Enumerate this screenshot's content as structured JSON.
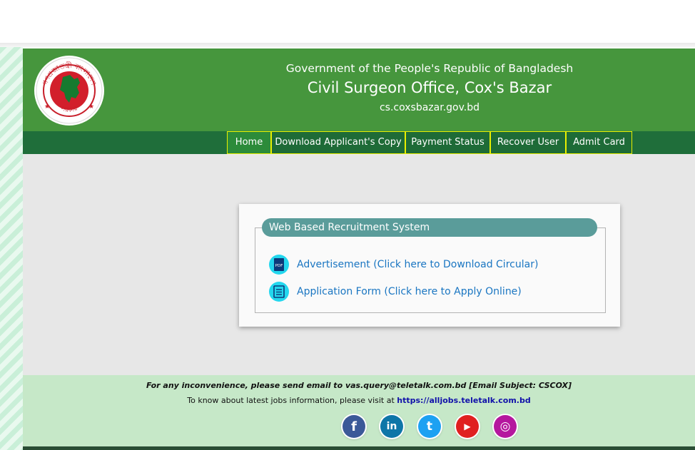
{
  "header": {
    "line1": "Government of the People's Republic of Bangladesh",
    "line2": "Civil Surgeon Office, Cox's Bazar",
    "line3": "cs.coxsbazar.gov.bd",
    "logo_text_top": "গণপ্রজাতন্ত্রী বাংলাদেশ",
    "logo_text_bottom": "সরকার"
  },
  "nav": {
    "items": [
      {
        "label": "Home"
      },
      {
        "label": "Download Applicant's Copy"
      },
      {
        "label": "Payment Status"
      },
      {
        "label": "Recover User"
      },
      {
        "label": "Admit Card"
      }
    ],
    "active": "Home"
  },
  "panel": {
    "legend": "Web Based Recruitment System",
    "links": [
      {
        "label": "Advertisement (Click here to Download Circular)",
        "icon": "pdf-icon"
      },
      {
        "label": "Application Form (Click here to Apply Online)",
        "icon": "form-icon"
      }
    ],
    "pdf_icon_text": "PDF"
  },
  "footer": {
    "line1": "For any inconvenience, please send email to vas.query@teletalk.com.bd [Email Subject: CSCOX]",
    "line2_prefix": "To know about latest jobs information, please visit at",
    "line2_link": "https://alljobs.teletalk.com.bd",
    "socials": [
      {
        "name": "facebook-icon",
        "glyph": "f",
        "color": "#3b5998"
      },
      {
        "name": "linkedin-icon",
        "glyph": "in",
        "color": "#0e76a8"
      },
      {
        "name": "twitter-icon",
        "glyph": "t",
        "color": "#1da1f2"
      },
      {
        "name": "youtube-icon",
        "glyph": "▶",
        "color": "#e02020"
      },
      {
        "name": "instagram-icon",
        "glyph": "◎",
        "color": "#b5179e"
      }
    ]
  },
  "colors": {
    "header_green": "#46963d",
    "nav_green": "#1f6e3a",
    "nav_border": "#e9ef00",
    "legend_teal": "#5a9c9a",
    "link_blue": "#1a76c2",
    "footer_green": "#c6e8c8"
  }
}
